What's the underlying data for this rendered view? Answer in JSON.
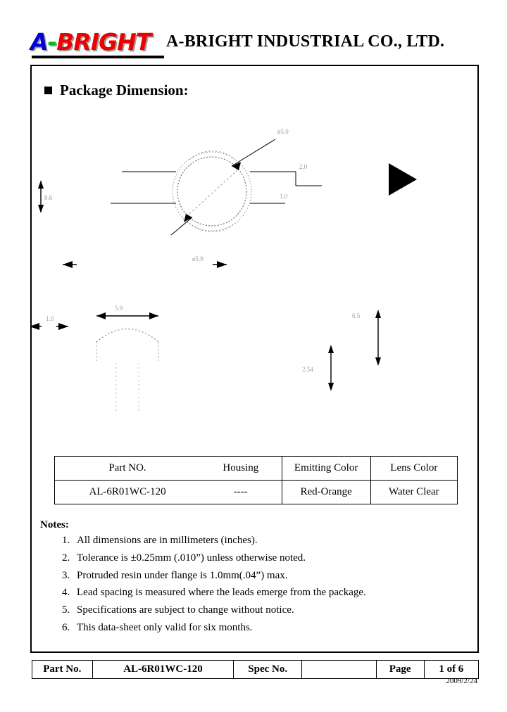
{
  "header": {
    "logo": {
      "letter_a": "A",
      "dash": "-",
      "rest": "BRIGHT"
    },
    "company_name": "A-BRIGHT INDUSTRIAL CO., LTD."
  },
  "section": {
    "title": "Package Dimension:"
  },
  "drawing": {
    "labels": {
      "top_right": "ø5.0",
      "right_upper": "2.0",
      "right_lower": "1.0",
      "left_vertical": "8.6",
      "bottom_center": "ø5.9",
      "width_dim": "5.9",
      "lead_left": "1.0",
      "lead_right_upper": "0.5",
      "lead_right_lower": "2.54",
      "cathode_mark": "▼"
    },
    "marker_icon": "right-triangle"
  },
  "spec_table": {
    "headers": [
      "Part NO.",
      "Housing",
      "Emitting Color",
      "Lens Color"
    ],
    "rows": [
      [
        "AL-6R01WC-120",
        "----",
        "Red-Orange",
        "Water Clear"
      ]
    ]
  },
  "notes": {
    "title": "Notes:",
    "items": [
      "All dimensions are in millimeters (inches).",
      "Tolerance is  ±0.25mm (.010”) unless otherwise noted.",
      "Protruded resin under flange is 1.0mm(.04”) max.",
      "Lead spacing is measured where the leads emerge from the package.",
      "Specifications are subject to change without notice.",
      "This data-sheet only valid for six months."
    ]
  },
  "footer": {
    "part_no_label": "Part No.",
    "part_no_value": "AL-6R01WC-120",
    "spec_no_label": "Spec No.",
    "spec_no_value": "",
    "page_label": "Page",
    "page_value": "1 of 6",
    "date": "2009/2/24"
  }
}
